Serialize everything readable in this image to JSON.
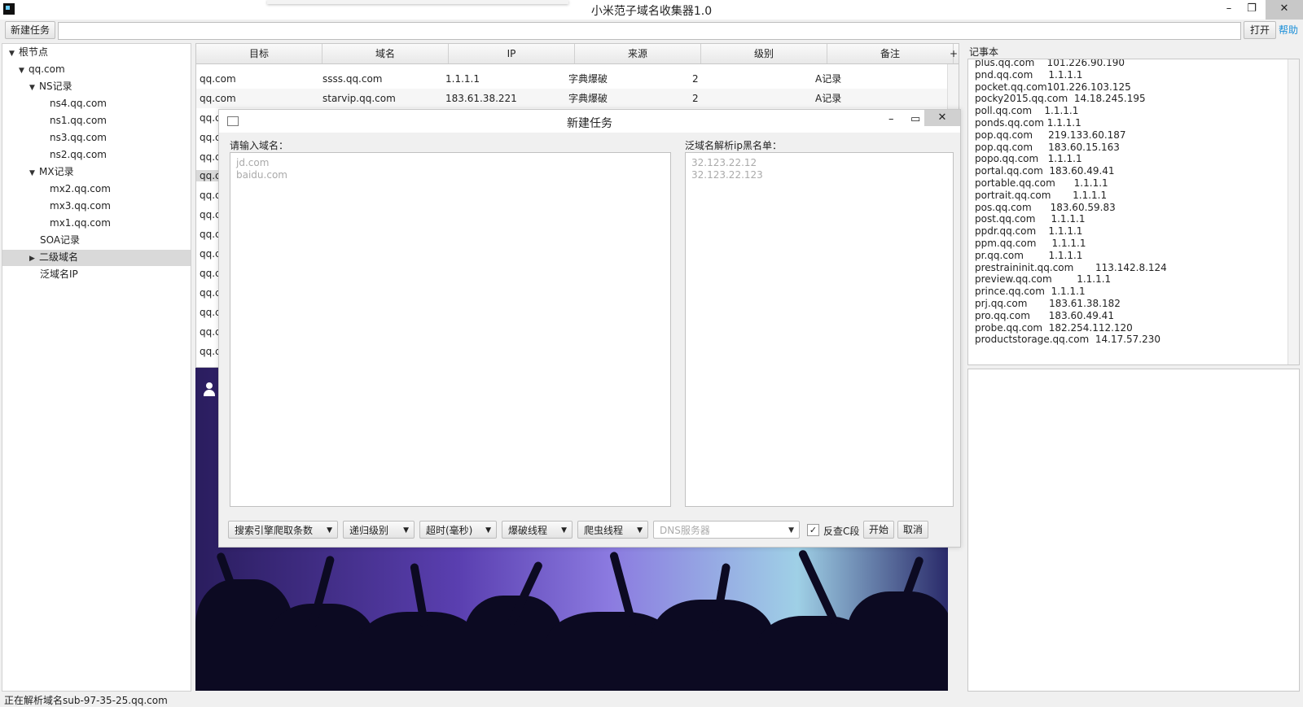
{
  "window": {
    "title": "小米范子域名收集器1.0",
    "minimize": "–",
    "maximize": "❐",
    "close": "✕"
  },
  "toolbar": {
    "new_task": "新建任务",
    "open": "打开",
    "help": "帮助",
    "address_value": ""
  },
  "tree": {
    "root": "根节点",
    "domain": "qq.com",
    "ns_label": "NS记录",
    "ns": [
      "ns4.qq.com",
      "ns1.qq.com",
      "ns3.qq.com",
      "ns2.qq.com"
    ],
    "mx_label": "MX记录",
    "mx": [
      "mx2.qq.com",
      "mx3.qq.com",
      "mx1.qq.com"
    ],
    "soa_label": "SOA记录",
    "subdomain_label": "二级域名",
    "wildcard_label": "泛域名IP"
  },
  "table": {
    "columns": [
      "目标",
      "域名",
      "IP",
      "来源",
      "级别",
      "备注"
    ],
    "add_col": "+",
    "rows": [
      [
        "qq.com",
        "ssss.qq.com",
        "1.1.1.1",
        "字典爆破",
        "2",
        "A记录"
      ],
      [
        "qq.com",
        "starvip.qq.com",
        "183.61.38.221",
        "字典爆破",
        "2",
        "A记录"
      ]
    ],
    "partial_rows": [
      "qq.c",
      "qq.c",
      "qq.c",
      "qq.c",
      "qq.c",
      "qq.c",
      "qq.c",
      "qq.c",
      "qq.c",
      "qq.c",
      "qq.c",
      "qq.c",
      "qq.c"
    ]
  },
  "notebook": {
    "label": "记事本",
    "lines": [
      "plus.qq.com    101.226.90.190",
      "pnd.qq.com     1.1.1.1",
      "pocket.qq.com101.226.103.125",
      "pocky2015.qq.com  14.18.245.195",
      "poll.qq.com    1.1.1.1",
      "ponds.qq.com 1.1.1.1",
      "pop.qq.com     219.133.60.187",
      "pop.qq.com     183.60.15.163",
      "popo.qq.com   1.1.1.1",
      "portal.qq.com  183.60.49.41",
      "portable.qq.com      1.1.1.1",
      "portrait.qq.com       1.1.1.1",
      "pos.qq.com      183.60.59.83",
      "post.qq.com     1.1.1.1",
      "ppdr.qq.com    1.1.1.1",
      "ppm.qq.com     1.1.1.1",
      "pr.qq.com        1.1.1.1",
      "prestraininit.qq.com       113.142.8.124",
      "preview.qq.com        1.1.1.1",
      "prince.qq.com  1.1.1.1",
      "prj.qq.com       183.61.38.182",
      "pro.qq.com      183.60.49.41",
      "probe.qq.com  182.254.112.120",
      "productstorage.qq.com  14.17.57.230"
    ]
  },
  "status": "正在解析域名sub-97-35-25.qq.com",
  "dialog": {
    "title": "新建任务",
    "domain_label": "请输入域名：",
    "domain_placeholder": [
      "jd.com",
      "baidu.com"
    ],
    "blacklist_label": "泛域名解析ip黑名单：",
    "blacklist_placeholder": [
      "32.123.22.12",
      "32.123.22.123"
    ],
    "combos": [
      "搜索引擎爬取条数",
      "递归级别",
      "超时(毫秒)",
      "爆破线程",
      "爬虫线程"
    ],
    "dns_placeholder": "DNS服务器",
    "reverse_c_label": "反查C段",
    "reverse_c_checked": true,
    "start": "开始",
    "cancel": "取消"
  }
}
